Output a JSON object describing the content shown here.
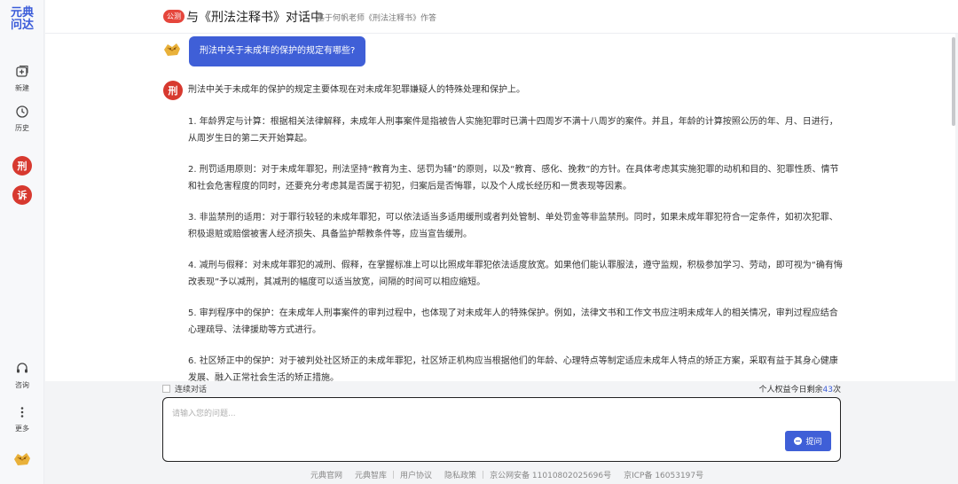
{
  "logo": {
    "line1": "元典",
    "line2": "问达"
  },
  "sidebar": {
    "new_label": "新建",
    "history_label": "历史",
    "bots": [
      "刑",
      "诉"
    ],
    "consult_label": "咨询",
    "more_label": "更多"
  },
  "header": {
    "tag": "公测",
    "title": "与《刑法注释书》对话中",
    "subtitle": "基于何帆老师《刑法注释书》作答"
  },
  "chat": {
    "question": "刑法中关于未成年的保护的规定有哪些?",
    "answer_avatar": "刑",
    "intro": "刑法中关于未成年的保护的规定主要体现在对未成年犯罪嫌疑人的特殊处理和保护上。",
    "items": [
      "1. 年龄界定与计算：根据相关法律解释，未成年人刑事案件是指被告人实施犯罪时已满十四周岁不满十八周岁的案件。并且，年龄的计算按照公历的年、月、日进行，从周岁生日的第二天开始算起。",
      "2. 刑罚适用原则：对于未成年罪犯，刑法坚持“教育为主、惩罚为辅”的原则，以及“教育、感化、挽救”的方针。在具体考虑其实施犯罪的动机和目的、犯罪性质、情节和社会危害程度的同时，还要充分考虑其是否属于初犯，归案后是否悔罪，以及个人成长经历和一贯表现等因素。",
      "3. 非监禁刑的适用：对于罪行较轻的未成年罪犯，可以依法适当多适用缓刑或者判处管制、单处罚金等非监禁刑。同时，如果未成年罪犯符合一定条件，如初次犯罪、积极退赃或赔偿被害人经济损失、具备监护帮教条件等，应当宣告缓刑。",
      "4. 减刑与假释：对未成年罪犯的减刑、假释，在掌握标准上可以比照成年罪犯依法适度放宽。如果他们能认罪服法，遵守监规，积极参加学习、劳动，即可视为“确有悔改表现”予以减刑，其减刑的幅度可以适当放宽，间隔的时间可以相应缩短。",
      "5. 审判程序中的保护：在未成年人刑事案件的审判过程中，也体现了对未成年人的特殊保护。例如，法律文书和工作文书应注明未成年人的相关情况，审判过程应结合心理疏导、法律援助等方式进行。",
      "6. 社区矫正中的保护：对于被判处社区矫正的未成年罪犯，社区矫正机构应当根据他们的年龄、心理特点等制定适应未成年人特点的矫正方案，采取有益于其身心健康发展、融入正常社会生活的矫正措施。"
    ]
  },
  "input": {
    "continuous_label": "连续对话",
    "quota_prefix": "个人权益今日剩余",
    "quota_count": "43",
    "quota_suffix": "次",
    "placeholder": "请输入您的问题...",
    "submit_label": "提问"
  },
  "footer": {
    "links": [
      "元典官网",
      "元典智库",
      "用户协议",
      "隐私政策",
      "京公网安备 11010802025696号",
      "京ICP备 16053197号"
    ]
  },
  "colors": {
    "accent": "#3f5fd7",
    "bot_red": "#d7392f",
    "tag_red": "#e5463c"
  }
}
